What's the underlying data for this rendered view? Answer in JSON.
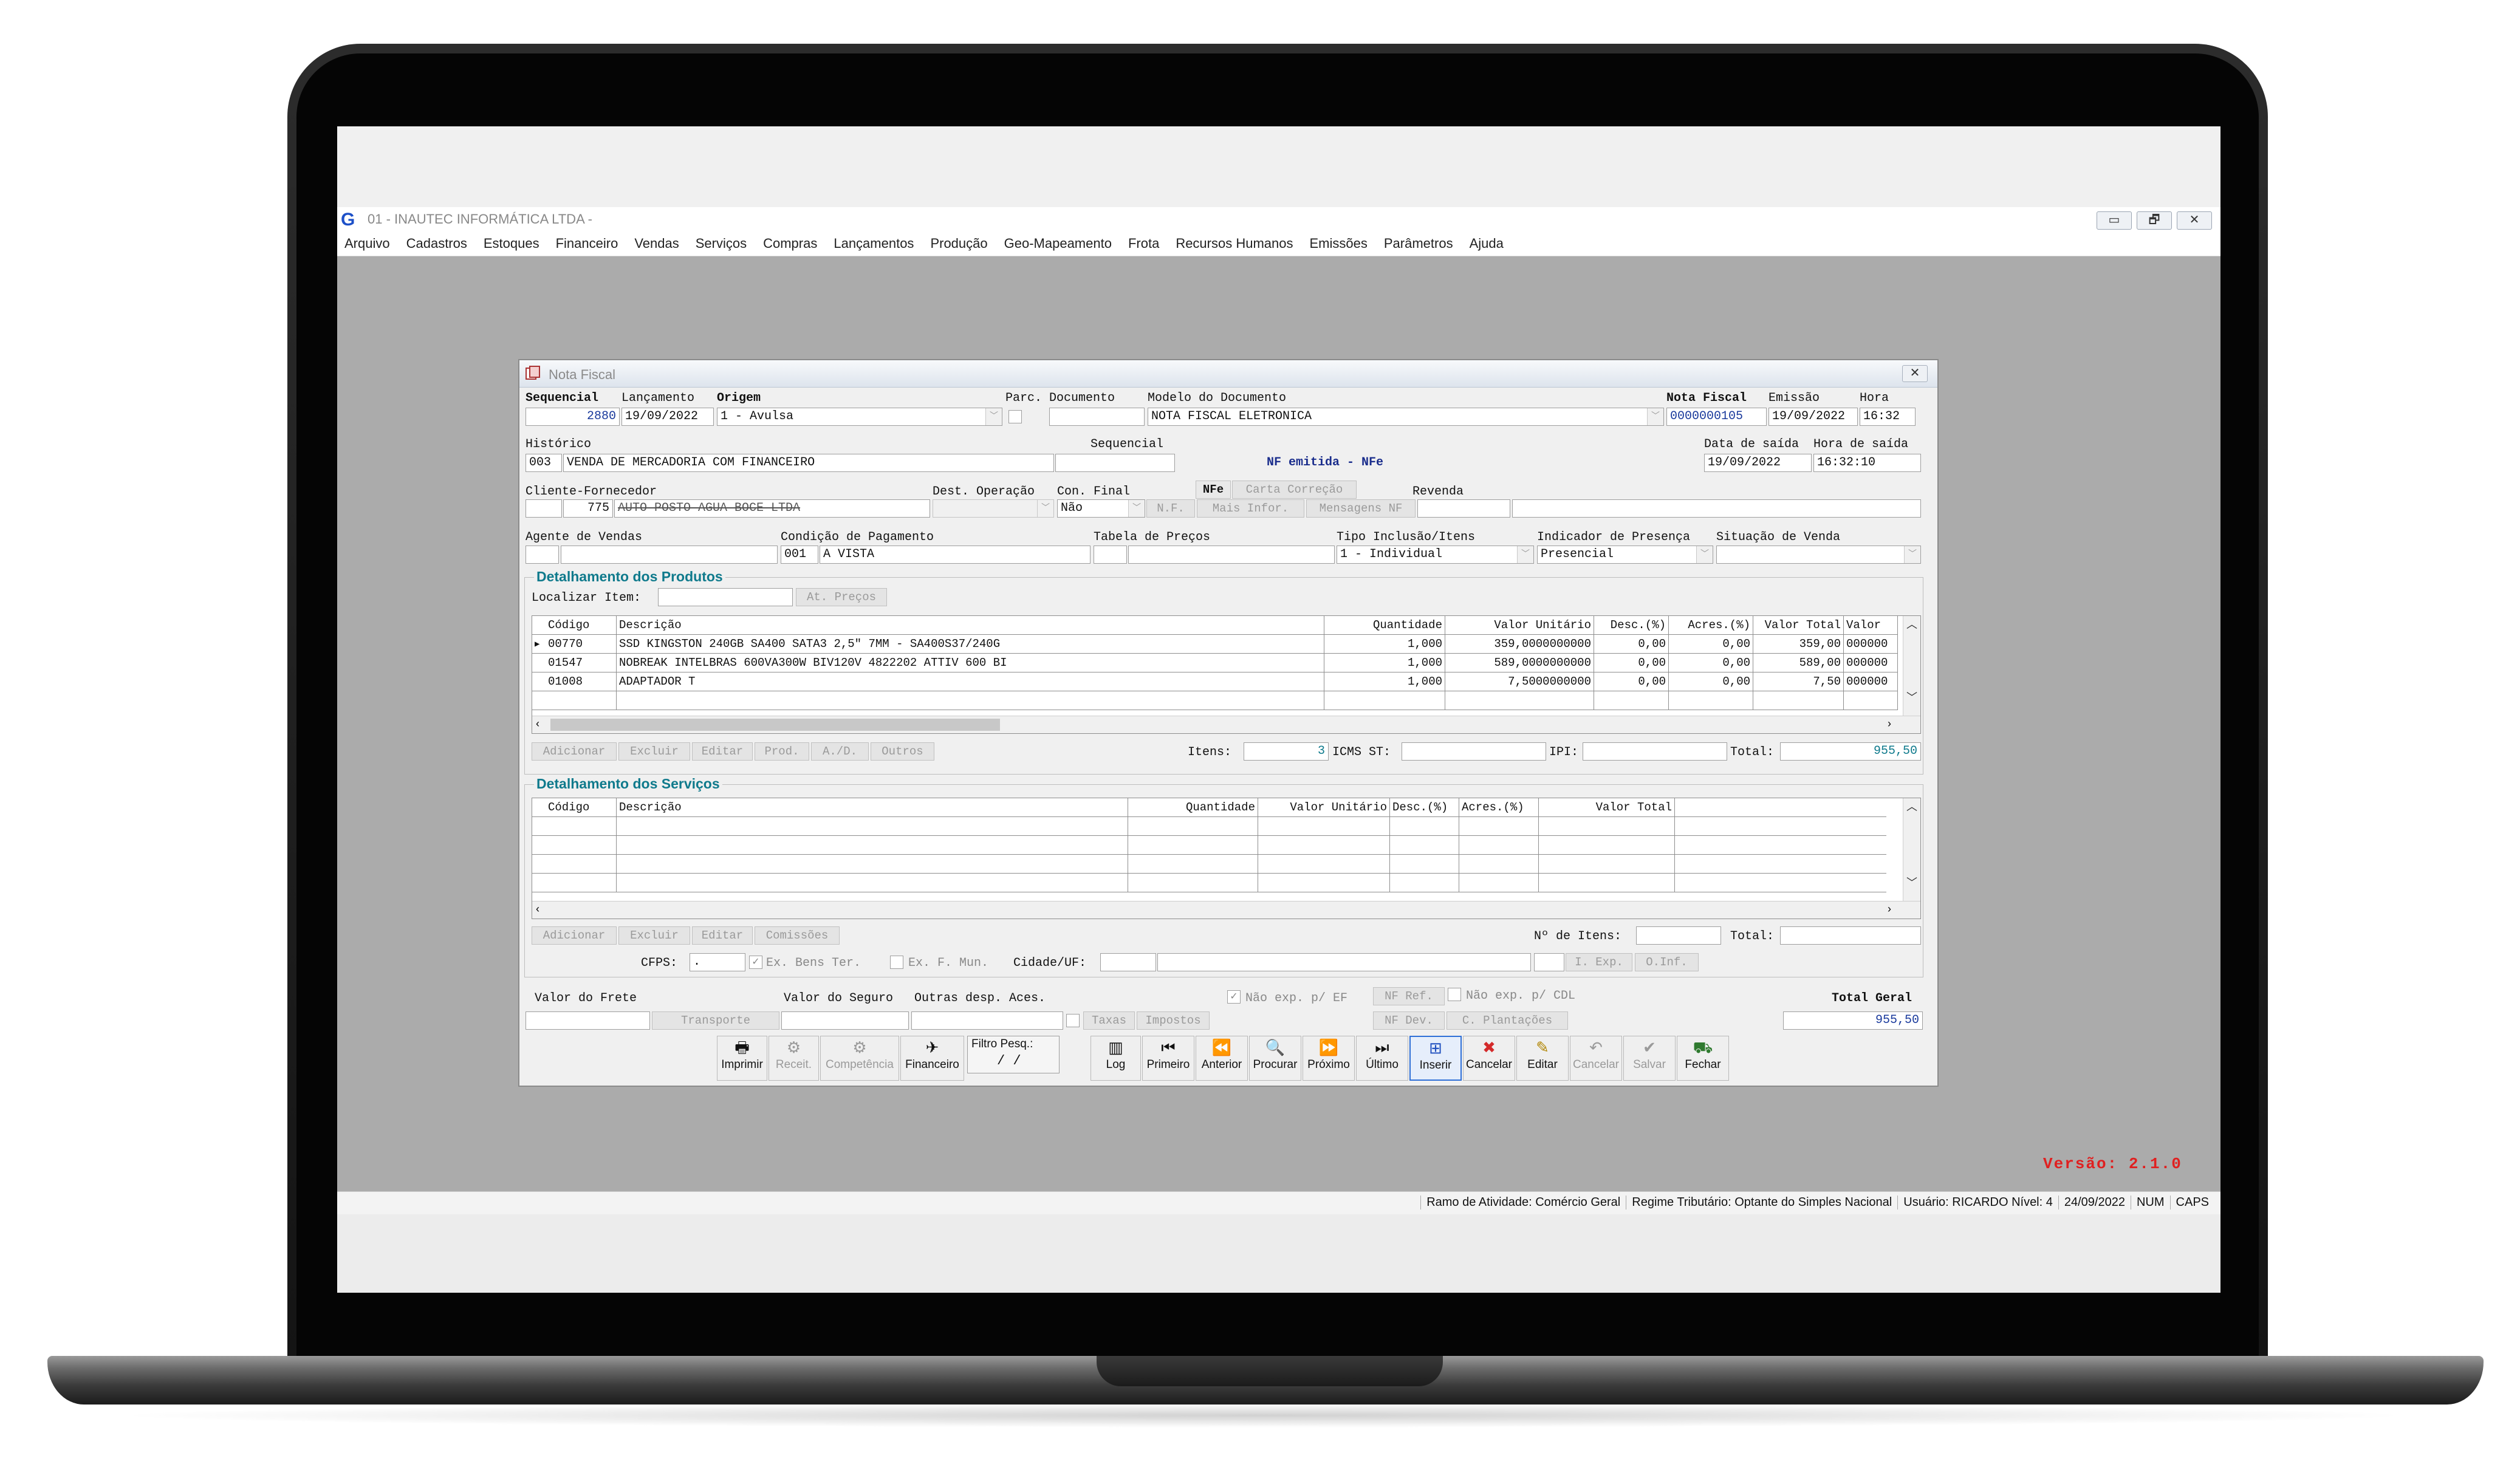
{
  "app": {
    "logo": "G",
    "title": "01 - INAUTEC INFORMÁTICA LTDA -",
    "window_buttons": [
      "▭",
      "🗗",
      "✕"
    ]
  },
  "menu": [
    "Arquivo",
    "Cadastros",
    "Estoques",
    "Financeiro",
    "Vendas",
    "Serviços",
    "Compras",
    "Lançamentos",
    "Produção",
    "Geo-Mapeamento",
    "Frota",
    "Recursos Humanos",
    "Emissões",
    "Parâmetros",
    "Ajuda"
  ],
  "dialog": {
    "title": "Nota Fiscal",
    "close": "✕",
    "labels": {
      "sequencial": "Sequencial",
      "lancamento": "Lançamento",
      "origem": "Origem",
      "parc": "Parc.",
      "documento": "Documento",
      "modelo": "Modelo do Documento",
      "nota_fiscal": "Nota Fiscal",
      "emissao": "Emissão",
      "hora": "Hora",
      "historico": "Histórico",
      "sequencial2": "Sequencial",
      "data_saida": "Data de saída",
      "hora_saida": "Hora de saída",
      "cliente": "Cliente-Fornecedor",
      "dest_operacao": "Dest. Operação",
      "con_final": "Con. Final",
      "revenda": "Revenda",
      "agente": "Agente de Vendas",
      "condicao": "Condição de Pagamento",
      "tabela": "Tabela de Preços",
      "tipo_inclusao": "Tipo Inclusão/Itens",
      "indicador": "Indicador de Presença",
      "situacao": "Situação de Venda"
    },
    "values": {
      "sequencial": "2880",
      "lancamento": "19/09/2022",
      "origem": "1 - Avulsa",
      "documento": "",
      "modelo": "NOTA FISCAL ELETRONICA",
      "nota_fiscal": "0000000105",
      "emissao": "19/09/2022",
      "hora": "16:32",
      "historico_code": "003",
      "historico": "VENDA DE MERCADORIA COM FINANCEIRO",
      "sequencial2": "",
      "nf_status": "NF emitida - NFe",
      "data_saida": "19/09/2022",
      "hora_saida": "16:32:10",
      "cliente_code": "775",
      "cliente_name": "AUTO POSTO AGUA BOCE LTDA",
      "con_final": "Não",
      "revenda": "",
      "condicao_code": "001",
      "condicao": "A VISTA",
      "tipo_inclusao": "1 - Individual",
      "indicador": "Presencial"
    },
    "nf_buttons": [
      "NFe",
      "Carta Correção",
      "N.F.",
      "Mais Infor.",
      "Mensagens NF"
    ],
    "produtos": {
      "title": "Detalhamento dos Produtos",
      "localizar_label": "Localizar Item:",
      "at_precos": "At. Preços",
      "columns": [
        "Código",
        "Descrição",
        "Quantidade",
        "Valor Unitário",
        "Desc.(%)",
        "Acres.(%)",
        "Valor Total",
        "Valor"
      ],
      "rows": [
        [
          "00770",
          "SSD KINGSTON 240GB SA400 SATA3 2,5\" 7MM - SA400S37/240G",
          "1,000",
          "359,0000000000",
          "0,00",
          "0,00",
          "359,00",
          "000000"
        ],
        [
          "01547",
          "NOBREAK INTELBRAS 600VA300W BIV120V 4822202 ATTIV 600 BI",
          "1,000",
          "589,0000000000",
          "0,00",
          "0,00",
          "589,00",
          "000000"
        ],
        [
          "01008",
          "ADAPTADOR T",
          "1,000",
          "7,5000000000",
          "0,00",
          "0,00",
          "7,50",
          "000000"
        ]
      ],
      "buttons": [
        "Adicionar",
        "Excluir",
        "Editar",
        "Prod.",
        "A./D.",
        "Outros"
      ],
      "itens_label": "Itens:",
      "itens": "3",
      "icms_label": "ICMS ST:",
      "ipi_label": "IPI:",
      "total_label": "Total:",
      "total": "955,50"
    },
    "servicos": {
      "title": "Detalhamento dos Serviços",
      "columns": [
        "Código",
        "Descrição",
        "Quantidade",
        "Valor Unitário",
        "Desc.(%)",
        "Acres.(%)",
        "Valor Total"
      ],
      "buttons": [
        "Adicionar",
        "Excluir",
        "Editar",
        "Comissões"
      ],
      "nitens_label": "Nº de Itens:",
      "total_label": "Total:",
      "cfps_label": "CFPS:",
      "cfps": ".",
      "ex_bens": "Ex. Bens Ter.",
      "ex_fmun": "Ex. F. Mun.",
      "cidade_label": "Cidade/UF:",
      "i_exp": "I. Exp.",
      "o_inf": "O.Inf."
    },
    "footer": {
      "frete_label": "Valor do Frete",
      "seguro_label": "Valor do Seguro",
      "outras_label": "Outras desp. Aces.",
      "transporte": "Transporte",
      "taxas": "Taxas",
      "impostos": "Impostos",
      "nao_exp_ef": "Não exp. p/ EF",
      "nf_ref": "NF Ref.",
      "nao_exp_cdl": "Não exp. p/ CDL",
      "nf_dev": "NF Dev.",
      "c_plantacoes": "C. Plantações",
      "total_geral_label": "Total Geral",
      "total_geral": "955,50"
    },
    "toolbar": {
      "filtro_label": "Filtro Pesq.:",
      "filtro_value": "/ /",
      "buttons": [
        {
          "label": "Imprimir",
          "icon": "🖶"
        },
        {
          "label": "Receit.",
          "icon": "⚙"
        },
        {
          "label": "Competência",
          "icon": "⚙"
        },
        {
          "label": "Financeiro",
          "icon": "✈"
        },
        {
          "label": "Log",
          "icon": "▥"
        },
        {
          "label": "Primeiro",
          "icon": "⏮"
        },
        {
          "label": "Anterior",
          "icon": "⏪"
        },
        {
          "label": "Procurar",
          "icon": "🔍"
        },
        {
          "label": "Próximo",
          "icon": "⏩"
        },
        {
          "label": "Último",
          "icon": "⏭"
        },
        {
          "label": "Inserir",
          "icon": "⊞"
        },
        {
          "label": "Cancelar",
          "icon": "✖"
        },
        {
          "label": "Editar",
          "icon": "✎"
        },
        {
          "label": "Cancelar",
          "icon": "↶"
        },
        {
          "label": "Salvar",
          "icon": "✔"
        },
        {
          "label": "Fechar",
          "icon": "⛟"
        }
      ]
    }
  },
  "version": "Versão: 2.1.0",
  "status": [
    "Ramo de Atividade: Comércio Geral",
    "Regime Tributário: Optante do Simples Nacional",
    "Usuário: RICARDO Nível: 4",
    "24/09/2022",
    "NUM",
    "CAPS"
  ],
  "colors": {
    "accent": "#0f7a8c",
    "version": "#e02020",
    "nfe_blue": "#1a2d8c",
    "workspace": "#ababab"
  }
}
